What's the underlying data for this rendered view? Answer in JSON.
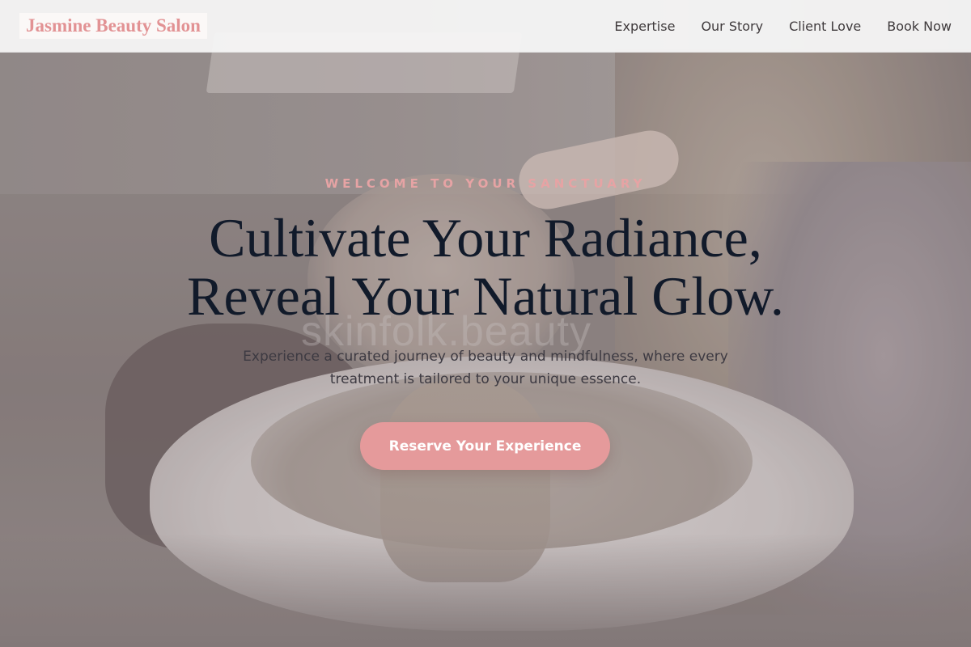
{
  "site": {
    "logo_text": "Jasmine Beauty Salon"
  },
  "nav": {
    "items": [
      {
        "label": "Expertise"
      },
      {
        "label": "Our Story"
      },
      {
        "label": "Client Love"
      },
      {
        "label": "Book Now"
      }
    ]
  },
  "hero": {
    "eyebrow": "WELCOME TO YOUR SANCTUARY",
    "headline_line1": "Cultivate Your Radiance,",
    "headline_line2": "Reveal Your Natural Glow.",
    "subtext_line1": "Experience a curated journey of beauty and mindfulness, where every",
    "subtext_line2": "treatment is tailored to your unique essence.",
    "cta_label": "Reserve Your Experience",
    "background_watermark": "skinfolk.beauty"
  },
  "colors": {
    "brand_pink": "#e29294",
    "cta_pink": "#e59a9b",
    "eyebrow_pink": "#e6a3a4",
    "headline_navy": "#111a2a",
    "nav_text": "#3f3a3c"
  }
}
